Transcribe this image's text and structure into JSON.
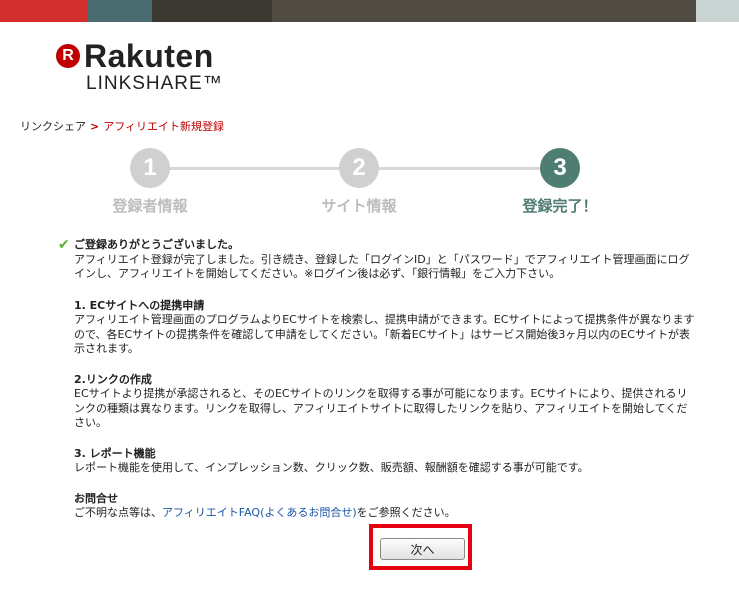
{
  "header": {
    "stripe_colors": [
      "#d32f2f",
      "#4a6b70",
      "#3b3731",
      "#4f4b43",
      "#c9d4d2"
    ]
  },
  "logo": {
    "mark": "R",
    "brand": "Rakuten",
    "product": "LINKSHARE™"
  },
  "breadcrumb": {
    "home": "リンクシェア",
    "separator": ">",
    "current": "アフィリエイト新規登録"
  },
  "steps": [
    {
      "number": "1",
      "label": "登録者情報",
      "state": "done"
    },
    {
      "number": "2",
      "label": "サイト情報",
      "state": "done"
    },
    {
      "number": "3",
      "label": "登録完了！",
      "state": "active"
    }
  ],
  "message": {
    "heading": "ご登録ありがとうございました。",
    "body": "アフィリエイト登録が完了しました。引き続き、登録した「ログインID」と「パスワード」でアフィリエイト管理画面にログインし、アフィリエイトを開始してください。※ログイン後は必ず、「銀行情報」をご入力下さい。"
  },
  "sections": [
    {
      "title": "1. ECサイトへの提携申請",
      "body": "アフィリエイト管理画面のプログラムよりECサイトを検索し、提携申請ができます。ECサイトによって提携条件が異なりますので、各ECサイトの提携条件を確認して申請をしてください。「新着ECサイト」はサービス開始後3ヶ月以内のECサイトが表示されます。"
    },
    {
      "title": "2.リンクの作成",
      "body": "ECサイトより提携が承認されると、そのECサイトのリンクを取得する事が可能になります。ECサイトにより、提供されるリンクの種類は異なります。リンクを取得し、アフィリエイトサイトに取得したリンクを貼り、アフィリエイトを開始してください。"
    },
    {
      "title": "3. レポート機能",
      "body": "レポート機能を使用して、インプレッション数、クリック数、販売額、報酬額を確認する事が可能です。"
    }
  ],
  "contact": {
    "title": "お問合せ",
    "prefix": "ご不明な点等は、",
    "link": "アフィリエイトFAQ(よくあるお問合せ)",
    "suffix": "をご参照ください。"
  },
  "next_button": {
    "label": "次へ"
  },
  "colors": {
    "brand_red": "#bf0000",
    "active_step": "#4f7d74",
    "inactive_step": "#d0d0d0",
    "highlight": "#e60012",
    "link": "#1a55a3"
  }
}
